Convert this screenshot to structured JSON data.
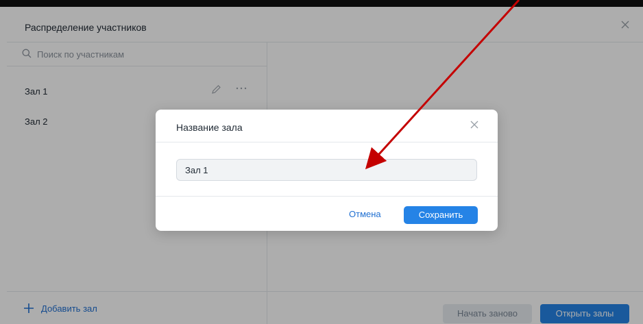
{
  "window": {
    "title": "Распределение участников"
  },
  "sidebar": {
    "search_placeholder": "Поиск по участникам",
    "halls": [
      {
        "label": "Зал 1"
      },
      {
        "label": "Зал 2"
      }
    ],
    "add_hall_label": "Добавить зал"
  },
  "footer": {
    "restart_label": "Начать заново",
    "open_label": "Открыть залы"
  },
  "dialog": {
    "title": "Название зала",
    "input_value": "Зал 1",
    "cancel_label": "Отмена",
    "save_label": "Сохранить"
  },
  "colors": {
    "accent": "#2583e6",
    "link": "#1f6fd1",
    "annotation_arrow": "#c40000",
    "overlay": "rgba(0,0,0,0.32)"
  },
  "icons": [
    "search-icon",
    "pencil-icon",
    "more-icon",
    "close-icon",
    "plus-icon"
  ]
}
